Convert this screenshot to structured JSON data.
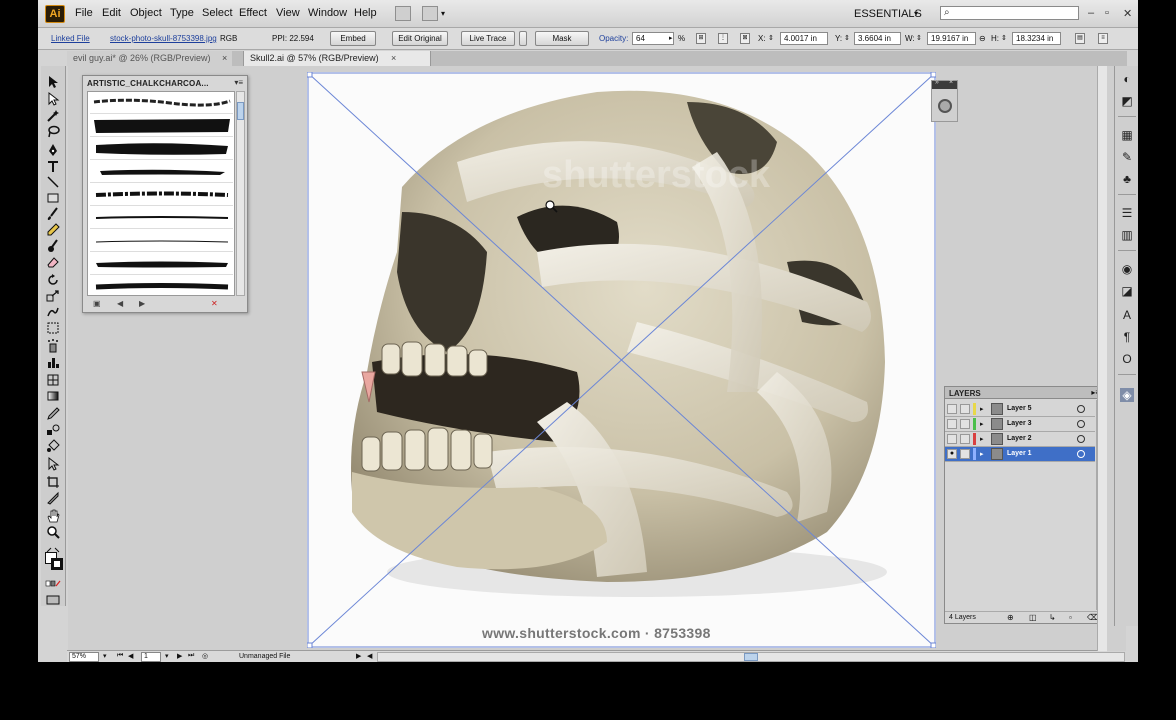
{
  "app": {
    "logo": "Ai",
    "menus": [
      "File",
      "Edit",
      "Object",
      "Type",
      "Select",
      "Effect",
      "View",
      "Window",
      "Help"
    ],
    "workspace": "ESSENTIALS"
  },
  "control_bar": {
    "linked_file_label": "Linked File",
    "file_name": "stock-photo-skull-8753398.jpg",
    "color_mode": "RGB",
    "ppi": "PPI: 22.594",
    "embed_button": "Embed",
    "edit_original_button": "Edit Original",
    "live_trace_button": "Live Trace",
    "mask_button": "Mask",
    "opacity_label": "Opacity:",
    "opacity_value": "64",
    "percent": "%",
    "x_label": "X:",
    "x_value": "4.0017 in",
    "y_label": "Y:",
    "y_value": "3.6604 in",
    "w_label": "W:",
    "w_value": "19.9167 in",
    "h_label": "H:",
    "h_value": "18.3234 in"
  },
  "tabs": [
    {
      "label": "evil guy.ai* @ 26% (RGB/Preview)",
      "active": false
    },
    {
      "label": "Skull2.ai @ 57% (RGB/Preview)",
      "active": true
    }
  ],
  "tab_close": "×",
  "brushes_panel": {
    "title": "ARTISTIC_CHALKCHARCOA...",
    "menu": "▾≡"
  },
  "artwork": {
    "watermark": "shutterstock",
    "credit": "www.shutterstock.com · 8753398"
  },
  "layers_panel": {
    "title": "LAYERS",
    "count": "4 Layers",
    "layers": [
      {
        "name": "Layer 5",
        "color": "#e8d84a",
        "selected": false
      },
      {
        "name": "Layer 3",
        "color": "#4bbf4b",
        "selected": false
      },
      {
        "name": "Layer 2",
        "color": "#d94040",
        "selected": false
      },
      {
        "name": "Layer 1",
        "color": "#3f6fc7",
        "selected": true
      }
    ]
  },
  "status_bar": {
    "zoom": "57%",
    "page": "1",
    "status": "Unmanaged File"
  },
  "colors": {
    "selection_blue": "#3f6fc7",
    "bounding_box": "#6b86d6"
  }
}
